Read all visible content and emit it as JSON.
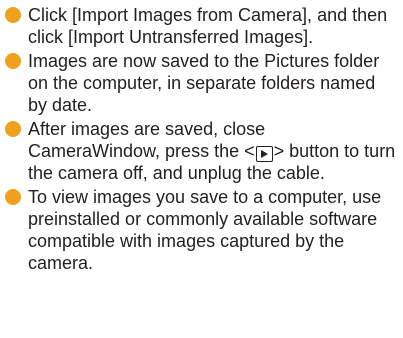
{
  "bullet_color": "#f0a01e",
  "items": [
    {
      "text": "Click [Import Images from Camera], and then click [Import Untransferred Images]."
    },
    {
      "text": "Images are now saved to the Pictures folder on the computer, in separate folders named by date."
    },
    {
      "text_before": "After images are saved, close CameraWindow, press the <",
      "icon": "play-button-icon",
      "text_after": "> button to turn the camera off, and unplug the cable."
    },
    {
      "text": "To view images you save to a computer, use preinstalled or commonly available software compatible with images captured by the camera."
    }
  ]
}
